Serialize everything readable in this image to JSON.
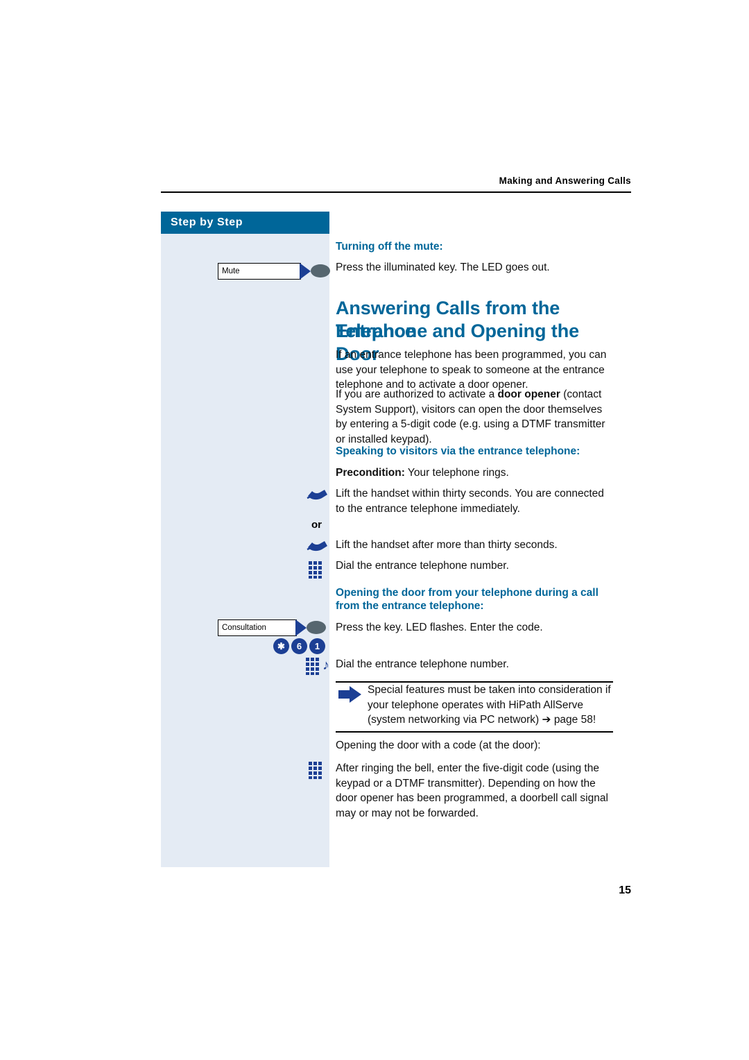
{
  "header": {
    "running_title": "Making and Answering Calls"
  },
  "sidebar": {
    "title": "Step by Step",
    "keys": [
      {
        "label": "Mute",
        "icon": "mute-key-with-led"
      },
      {
        "label": "Consultation",
        "icon": "consultation-key-with-led"
      }
    ],
    "icons": [
      "handset-icon",
      "handset-icon",
      "keypad-icon",
      "star-key-icon",
      "digit-6-key-icon",
      "digit-1-key-icon",
      "keypad-icon",
      "tone-icon",
      "keypad-icon"
    ],
    "or_label": "or",
    "star_symbol": "✱",
    "digit_six": "6",
    "digit_one": "1"
  },
  "content": {
    "mute_heading": "Turning off the mute:",
    "mute_text": "Press the illuminated key. The LED goes out.",
    "main_title_line1": "Answering Calls from the Entrance",
    "main_title_line2": "Telephone and Opening the Door",
    "intro_p1": "If an entrance telephone has been programmed, you can use your telephone to speak to someone at the entrance telephone and to activate a door opener.",
    "intro_p2_before": "If you are authorized to activate a ",
    "intro_p2_bold": "door opener",
    "intro_p2_after": " (contact System Support), visitors can open the door themselves by entering a 5-digit code (e.g. using a DTMF transmitter or installed keypad).",
    "speaking_heading": "Speaking to visitors via the entrance telephone:",
    "precondition_bold": "Precondition:",
    "precondition_text": " Your telephone rings.",
    "lift_within": "Lift the handset within thirty seconds. You are connected to the entrance telephone immediately.",
    "lift_after": "Lift the handset after more than thirty seconds.",
    "dial_number_1": "Dial the entrance telephone number.",
    "opening_heading_line1": "Opening the door from your telephone during a call",
    "opening_heading_line2": "from the entrance telephone:",
    "press_key_led": "Press the key. LED flashes. Enter the code.",
    "dial_number_2": "Dial the entrance telephone number.",
    "note_text": "Special features must be taken into consideration if your telephone operates with HiPath AllServe (system networking via PC network) ➔ page 58!",
    "opening_code_line": "Opening the door with a code (at the door):",
    "after_ringing": "After ringing the bell, enter the five-digit code (using the keypad or a DTMF transmitter). Depending on how the door opener has been programmed, a doorbell call signal may or may not be forwarded."
  },
  "footer": {
    "page_number": "15"
  },
  "colors": {
    "accent_blue": "#006699",
    "sidebar_bg": "#e4ebf4",
    "icon_blue": "#1c3f94"
  }
}
